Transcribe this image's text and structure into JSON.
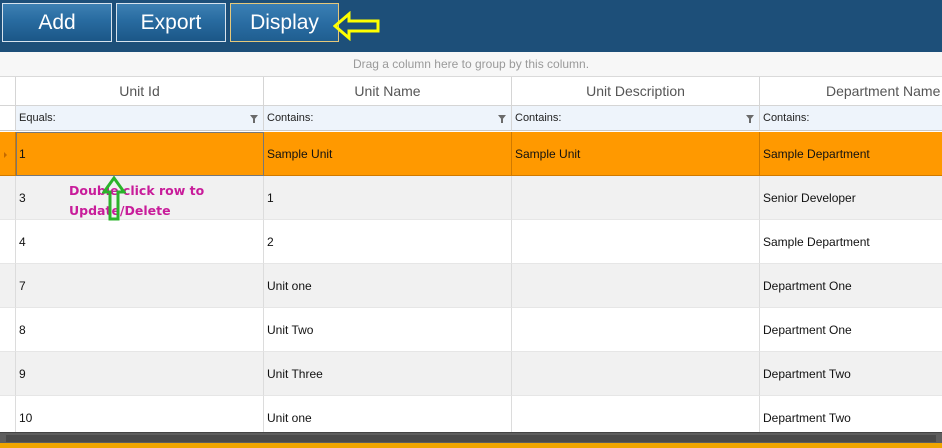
{
  "toolbar": {
    "buttons": [
      {
        "label": "Add"
      },
      {
        "label": "Export"
      },
      {
        "label": "Display"
      }
    ]
  },
  "grid": {
    "group_hint": "Drag a column here to group by this column.",
    "columns": [
      {
        "header": "Unit Id",
        "filter": "Equals:"
      },
      {
        "header": "Unit Name",
        "filter": "Contains:"
      },
      {
        "header": "Unit Description",
        "filter": "Contains:"
      },
      {
        "header": "Department Name",
        "filter": "Contains:"
      }
    ],
    "rows": [
      {
        "unit_id": "1",
        "unit_name": "Sample Unit",
        "unit_description": "Sample Unit",
        "department_name": "Sample Department"
      },
      {
        "unit_id": "3",
        "unit_name": "1",
        "unit_description": "",
        "department_name": "Senior Developer"
      },
      {
        "unit_id": "4",
        "unit_name": "2",
        "unit_description": "",
        "department_name": "Sample Department"
      },
      {
        "unit_id": "7",
        "unit_name": "Unit one",
        "unit_description": "",
        "department_name": "Department One"
      },
      {
        "unit_id": "8",
        "unit_name": "Unit Two",
        "unit_description": "",
        "department_name": "Department One"
      },
      {
        "unit_id": "9",
        "unit_name": "Unit Three",
        "unit_description": "",
        "department_name": "Department Two"
      },
      {
        "unit_id": "10",
        "unit_name": "Unit one",
        "unit_description": "",
        "department_name": "Department Two"
      }
    ],
    "selected_row": 0
  },
  "annotation": {
    "line1": "Double click row to",
    "line2": "Update/Delete"
  },
  "colors": {
    "toolbar_bg": "#1d4f79",
    "selected_row": "#ff9900",
    "alt_row": "#f1f1f1",
    "annotation_text": "#c81c9a",
    "green_arrow": "#2bb32b",
    "yellow_arrow": "#ffff00"
  },
  "icons": [
    "yellow-arrow-icon",
    "green-arrow-icon",
    "filter-funnel-icon"
  ]
}
